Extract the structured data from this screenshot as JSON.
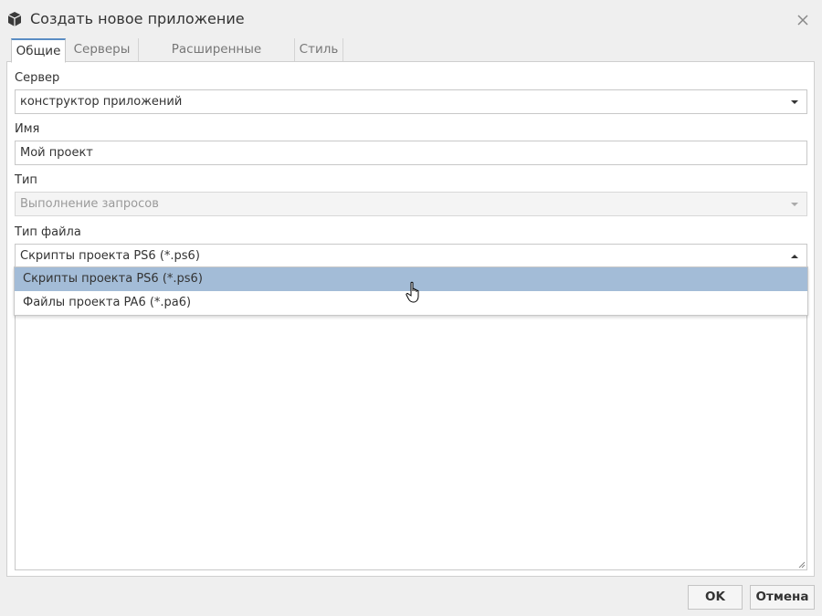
{
  "window": {
    "title": "Создать новое приложение",
    "icon": "cube-icon"
  },
  "tabs": [
    {
      "label": "Общие",
      "active": true
    },
    {
      "label": "Серверы",
      "active": false
    },
    {
      "label": "Расширенные настройки",
      "active": false
    },
    {
      "label": "Стиль",
      "active": false
    }
  ],
  "form": {
    "server": {
      "label": "Сервер",
      "value": "конструктор приложений"
    },
    "name": {
      "label": "Имя",
      "value": "Мой проект"
    },
    "type": {
      "label": "Тип",
      "value": "Выполнение запросов",
      "disabled": true
    },
    "file_type": {
      "label": "Тип файла",
      "value": "Скрипты проекта PS6 (*.ps6)",
      "open": true,
      "options": [
        {
          "label": "Скрипты проекта PS6 (*.ps6)",
          "highlighted": true
        },
        {
          "label": "Файлы проекта PA6 (*.pa6)",
          "highlighted": false
        }
      ]
    }
  },
  "buttons": {
    "ok": "OK",
    "cancel": "Отмена"
  },
  "colors": {
    "highlight": "#a3bcd7",
    "tab_accent": "#5a8dc4",
    "background": "#efefef"
  }
}
